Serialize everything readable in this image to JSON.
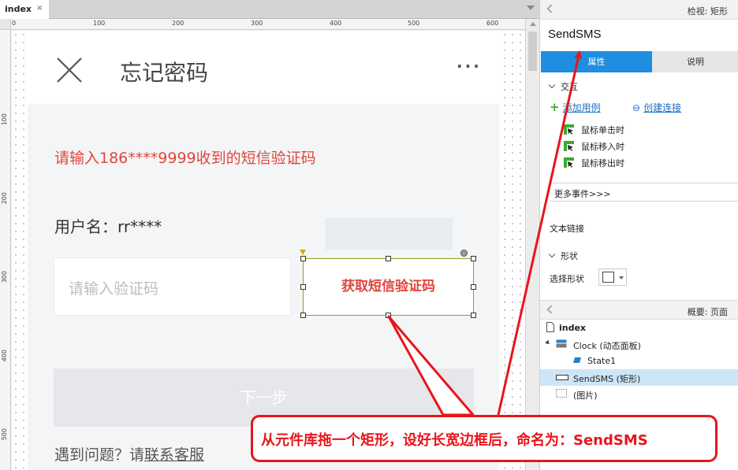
{
  "tab": {
    "label": "index",
    "close": "×"
  },
  "ruler": {
    "h_labels": [
      "0",
      "100",
      "200",
      "300",
      "400",
      "500",
      "600"
    ],
    "v_labels": [
      "100",
      "200",
      "300",
      "400",
      "500"
    ]
  },
  "mockup": {
    "title": "忘记密码",
    "more": "···",
    "sms_hint": "请输入186****9999收到的短信验证码",
    "username": "用户名：rr****",
    "code_placeholder": "请输入验证码",
    "get_code_button": "获取短信验证码",
    "next_button": "下一步",
    "help_prefix": "遇到问题？请",
    "help_link": "联系客服"
  },
  "inspector": {
    "header": "检视: 矩形",
    "shape_name": "SendSMS",
    "tabs": [
      "属性",
      "说明"
    ],
    "interaction_section": "交互",
    "add_case": "添加用例",
    "create_link": "创建连接",
    "events": [
      "鼠标单击时",
      "鼠标移入时",
      "鼠标移出时"
    ],
    "more_events": "更多事件>>>",
    "text_link": "文本链接",
    "shape_section": "形状",
    "choose_shape": "选择形状"
  },
  "outline": {
    "header": "概要: 页面",
    "items": [
      {
        "label": "index",
        "icon": "page-icon"
      },
      {
        "label": "Clock (动态面板)",
        "icon": "dynamic-panel-icon"
      },
      {
        "label": "State1",
        "icon": "state-icon"
      },
      {
        "label": "SendSMS (矩形)",
        "icon": "rectangle-icon"
      },
      {
        "label": "(图片)",
        "icon": "image-icon"
      }
    ]
  },
  "annotation": {
    "callout_text": "从元件库拖一个矩形，设好长宽边框后，命名为：SendSMS",
    "color": "#e8151b"
  },
  "colors": {
    "accent": "#1f8de0",
    "hint_red": "#e0463b",
    "link_blue": "#1a6fc0",
    "selection_border": "#9a9a1e"
  }
}
